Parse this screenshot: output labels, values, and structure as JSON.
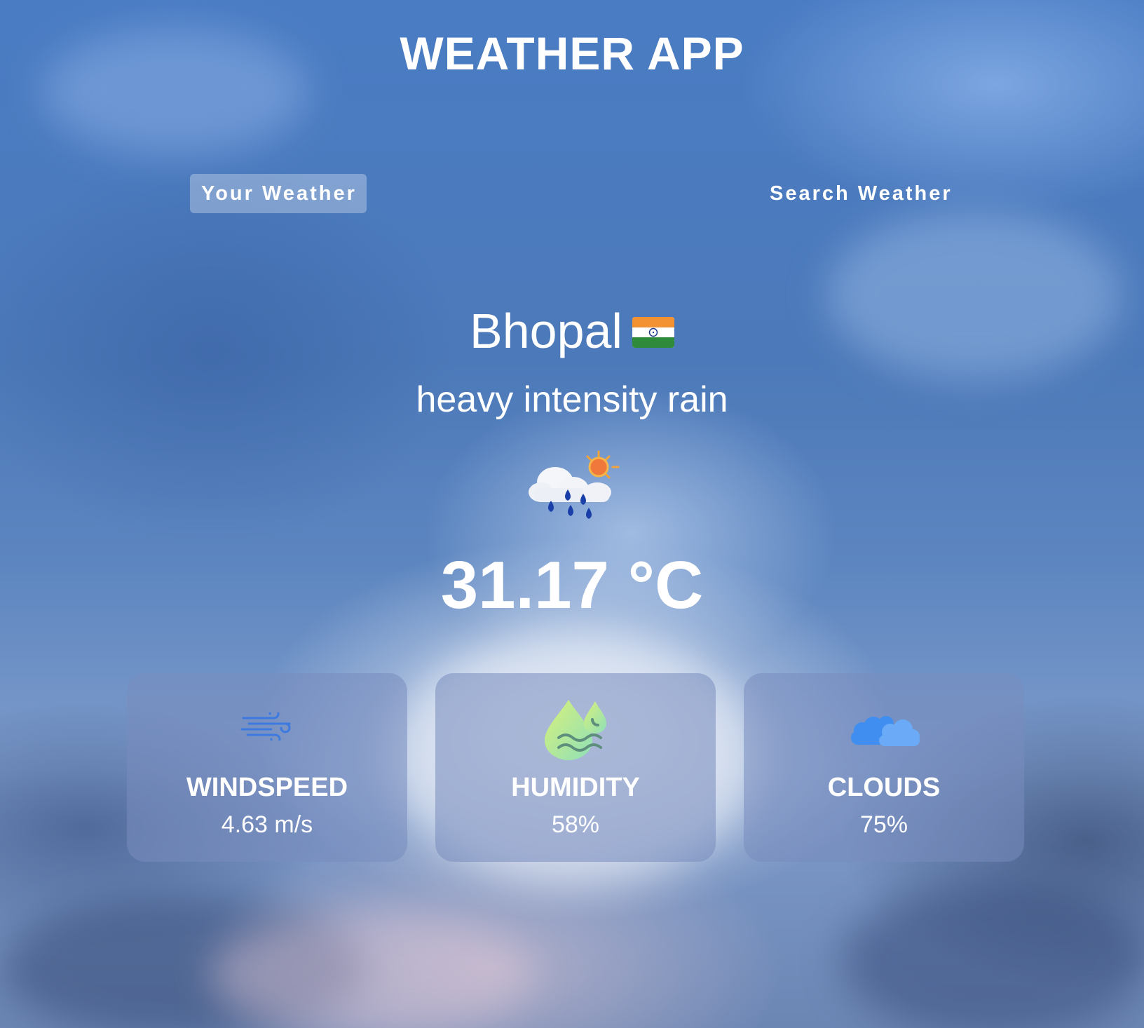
{
  "app": {
    "title": "WEATHER APP"
  },
  "tabs": [
    {
      "label": "Your Weather",
      "active": true
    },
    {
      "label": "Search Weather",
      "active": false
    }
  ],
  "weather": {
    "city": "Bhopal",
    "country_flag_icon": "india-flag-icon",
    "description": "heavy intensity rain",
    "condition_icon": "rain-cloud-sun-icon",
    "temperature": "31.17 °C"
  },
  "stats": [
    {
      "label": "WINDSPEED",
      "value": "4.63 m/s",
      "icon": "wind-icon"
    },
    {
      "label": "HUMIDITY",
      "value": "58%",
      "icon": "humidity-icon"
    },
    {
      "label": "CLOUDS",
      "value": "75%",
      "icon": "clouds-icon"
    }
  ],
  "colors": {
    "wind_icon": "#3d7ae0",
    "humidity_icon_start": "#d8f07a",
    "humidity_icon_end": "#8fe0b8",
    "clouds_icon": "#3f8ef0",
    "card_background": "rgba(120,140,190,0.55)",
    "active_tab_background": "rgba(255,255,255,0.3)"
  }
}
